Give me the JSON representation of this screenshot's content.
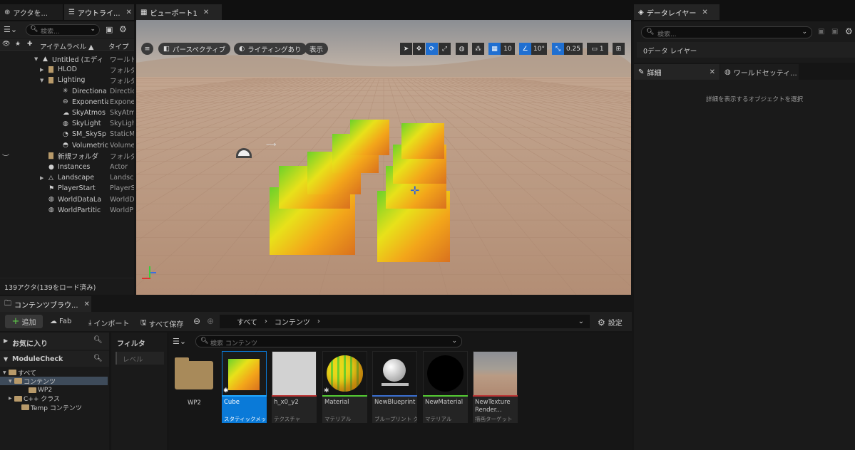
{
  "tabs": {
    "actor": "アクタを...",
    "outliner": "アウトライ...",
    "viewport": "ビューポート1",
    "data_layers": "データレイヤー",
    "details": "詳細",
    "world_settings": "ワールドセッティ..."
  },
  "outliner": {
    "search_placeholder": "検索...",
    "col_label": "アイテムラベル ▲",
    "col_type": "タイプ",
    "rows": [
      {
        "label": "Untitled (エディ",
        "type": "ワールド"
      },
      {
        "label": "HLOD",
        "type": "フォルダ"
      },
      {
        "label": "Lighting",
        "type": "フォルダ"
      },
      {
        "label": "Directiona",
        "type": "Directio"
      },
      {
        "label": "Exponentia",
        "type": "Expone"
      },
      {
        "label": "SkyAtmos",
        "type": "SkyAtm"
      },
      {
        "label": "SkyLight",
        "type": "SkyLigh"
      },
      {
        "label": "SM_SkySp",
        "type": "StaticM"
      },
      {
        "label": "Volumetric",
        "type": "Volume"
      },
      {
        "label": "新規フォルダ",
        "type": "フォルダ"
      },
      {
        "label": "Instances",
        "type": "Actor"
      },
      {
        "label": "Landscape",
        "type": "Landsc"
      },
      {
        "label": "PlayerStart",
        "type": "PlayerS"
      },
      {
        "label": "WorldDataLa",
        "type": "WorldD"
      },
      {
        "label": "WorldPartitic",
        "type": "WorldP"
      }
    ],
    "status": "139アクタ(139をロード済み)"
  },
  "viewport": {
    "perspective": "パースペクティブ",
    "lighting": "ライティングあり",
    "show": "表示",
    "grid_snap": "10",
    "rot_snap": "10°",
    "scale_snap": "0.25",
    "cam_speed": "1"
  },
  "data_layers": {
    "search_placeholder": "検索...",
    "count": "0データ レイヤー"
  },
  "details": {
    "empty": "詳細を表示するオブジェクトを選択"
  },
  "content_browser": {
    "tab": "コンテンツブラウ...",
    "add": "追加",
    "fab": "Fab",
    "import": "インポート",
    "save_all": "すべて保存",
    "path_all": "すべて",
    "path_content": "コンテンツ",
    "settings": "設定",
    "favorites": "お気に入り",
    "module": "ModuleCheck",
    "tree": [
      {
        "label": "すべて"
      },
      {
        "label": "コンテンツ"
      },
      {
        "label": "WP2"
      },
      {
        "label": "C++ クラス"
      },
      {
        "label": "Temp コンテンツ"
      }
    ],
    "filter_title": "フィルタ",
    "filter_level": "レベル",
    "search_placeholder": "検索 コンテンツ",
    "assets": [
      {
        "name": "WP2",
        "type": ""
      },
      {
        "name": "Cube",
        "type": "スタティックメッシュ"
      },
      {
        "name": "h_x0_y2",
        "type": "テクスチャ"
      },
      {
        "name": "Material",
        "type": "マテリアル"
      },
      {
        "name": "NewBlueprint",
        "type": "ブループリント クラス"
      },
      {
        "name": "NewMaterial",
        "type": "マテリアル"
      },
      {
        "name": "NewTexture\nRender...",
        "type": "描画ターゲット"
      }
    ]
  },
  "colors": {
    "accent": "#1f6fd1",
    "selected": "#0a7ad8"
  }
}
